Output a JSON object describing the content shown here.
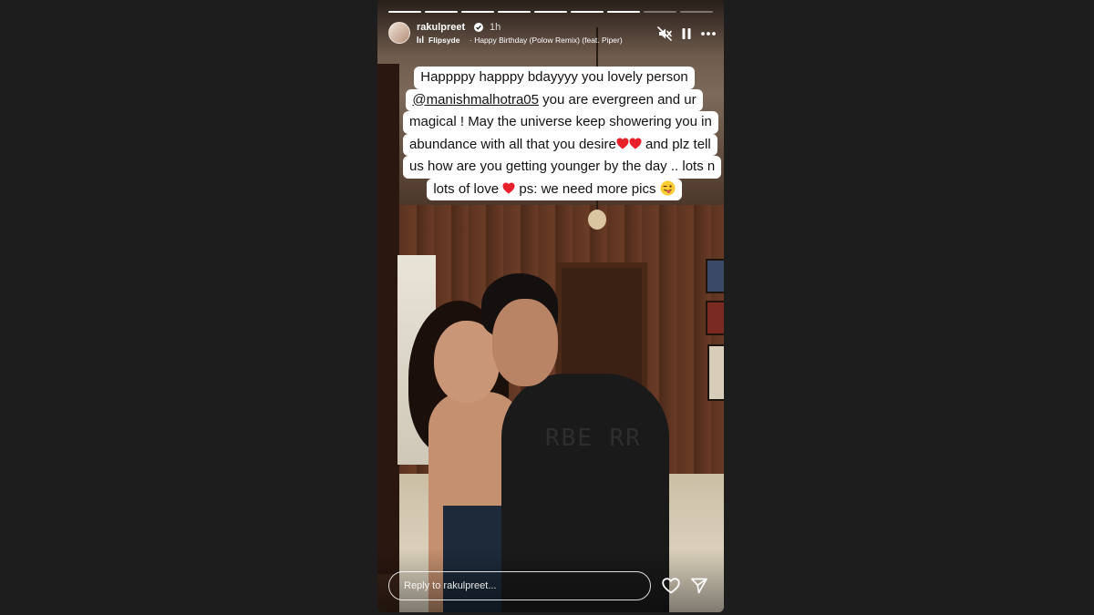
{
  "story": {
    "progress": {
      "segments_total": 9,
      "segments_viewed": 7
    },
    "header": {
      "username": "rakulpreet",
      "verified": true,
      "time_ago": "1h",
      "music": {
        "artist": "Flipsyde",
        "song": "· Happy Birthday (Polow Remix) (feat. Piper)"
      },
      "controls": [
        "speaker-muted-icon",
        "pause-icon",
        "more-icon"
      ]
    },
    "caption": {
      "line1": "Happppy happpy bdayyyy you lovely person",
      "mention": "@manishmalhotra05",
      "line2_rest": " you are evergreen and ur",
      "line3": "magical ! May the universe keep showering you in",
      "line4": "abundance with all that you desire",
      "line4_after": " and plz tell",
      "line5": "us how are you getting younger by the day .. lots n",
      "line6a": "lots of love ",
      "line6b": " ps: we need more pics "
    },
    "photo_text": {
      "jacket_print": "RBE RR"
    },
    "reply": {
      "placeholder": "Reply to rakulpreet..."
    },
    "colors": {
      "heart": "#e8202a",
      "background": "#1d1d1d"
    }
  }
}
